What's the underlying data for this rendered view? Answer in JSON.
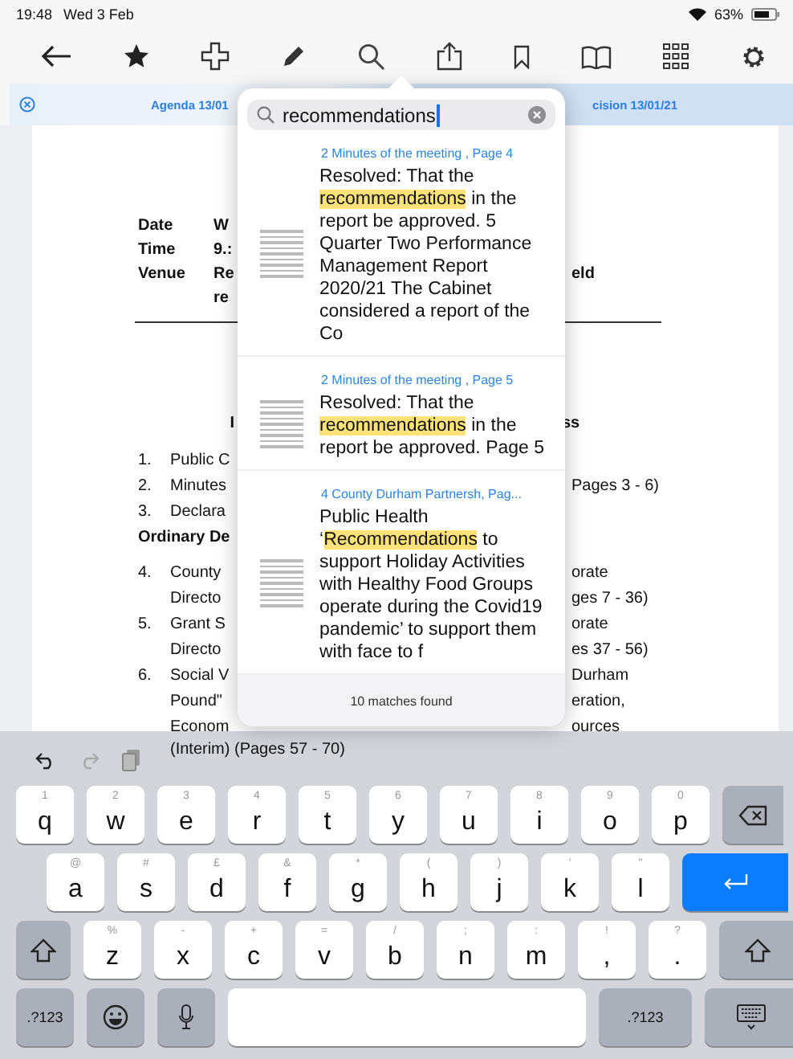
{
  "status_bar": {
    "time": "19:48",
    "date": "Wed 3 Feb",
    "battery": "63%"
  },
  "tabs": [
    {
      "label": "Agenda 13/01",
      "selected": false
    },
    {
      "label": "cision 13/01/21",
      "selected": true
    }
  ],
  "document": {
    "header": [
      {
        "label": "Date",
        "value": "W"
      },
      {
        "label": "Time",
        "value": "9.:"
      },
      {
        "label": "Venue",
        "value": "Re",
        "right": "eld"
      },
      {
        "value": "re"
      }
    ],
    "heading": {
      "left": "I",
      "right": "ss"
    },
    "items": [
      {
        "kind": "item",
        "num": "1.",
        "left": "Public C"
      },
      {
        "kind": "item",
        "num": "2.",
        "left": "Minutes",
        "right": "Pages 3 - 6)"
      },
      {
        "kind": "item",
        "num": "3.",
        "left": "Declara"
      },
      {
        "kind": "section",
        "left": "Ordinary De"
      },
      {
        "kind": "item",
        "num": "4.",
        "left": "County",
        "right": "orate"
      },
      {
        "kind": "item",
        "left": "Directo",
        "right": "ges 7 - 36)"
      },
      {
        "kind": "item",
        "num": "5.",
        "left": "Grant S",
        "right": "orate"
      },
      {
        "kind": "item",
        "left": "Directo",
        "right": "es 37 - 56)"
      },
      {
        "kind": "item",
        "num": "6.",
        "left": "Social V",
        "right": "Durham"
      },
      {
        "kind": "item",
        "left": "Pound\"",
        "right": "eration,"
      },
      {
        "kind": "item",
        "left": "Econom",
        "right": "ources"
      }
    ],
    "footer_line": "(Interim)  (Pages 57 - 70)"
  },
  "search": {
    "value": "recommendations",
    "results": [
      {
        "source": "2 Minutes of the meeting , Page 4",
        "before": "Resolved: That the ",
        "match": "recommendations",
        "after": " in the report be approved. 5 Quarter Two Performance Management Report 2020/21 The Cabinet considered a report of the Co"
      },
      {
        "source": "2 Minutes of the meeting , Page 5",
        "before": "Resolved: That the ",
        "match": "recommendations",
        "after": " in the report be approved. Page 5"
      },
      {
        "source": "4 County Durham Partnersh, Pag...",
        "before": "Public Health ‘",
        "match": "Recommendations",
        "after": " to support Holiday Activities with Healthy Food Groups operate during the Covid19 pandemic’ to support them with face to f"
      }
    ],
    "count": "10 matches found"
  },
  "keyboard": {
    "rows": [
      [
        {
          "kind": "char",
          "label": "q",
          "hint": "1"
        },
        {
          "kind": "char",
          "label": "w",
          "hint": "2"
        },
        {
          "kind": "char",
          "label": "e",
          "hint": "3"
        },
        {
          "kind": "char",
          "label": "r",
          "hint": "4"
        },
        {
          "kind": "char",
          "label": "t",
          "hint": "5"
        },
        {
          "kind": "char",
          "label": "y",
          "hint": "6"
        },
        {
          "kind": "char",
          "label": "u",
          "hint": "7"
        },
        {
          "kind": "char",
          "label": "i",
          "hint": "8"
        },
        {
          "kind": "char",
          "label": "o",
          "hint": "9"
        },
        {
          "kind": "char",
          "label": "p",
          "hint": "0"
        },
        {
          "kind": "backspace"
        }
      ],
      [
        {
          "kind": "char",
          "label": "a",
          "hint": "@"
        },
        {
          "kind": "char",
          "label": "s",
          "hint": "#"
        },
        {
          "kind": "char",
          "label": "d",
          "hint": "£"
        },
        {
          "kind": "char",
          "label": "f",
          "hint": "&"
        },
        {
          "kind": "char",
          "label": "g",
          "hint": "*"
        },
        {
          "kind": "char",
          "label": "h",
          "hint": "("
        },
        {
          "kind": "char",
          "label": "j",
          "hint": ")"
        },
        {
          "kind": "char",
          "label": "k",
          "hint": "'"
        },
        {
          "kind": "char",
          "label": "l",
          "hint": "\""
        },
        {
          "kind": "return"
        }
      ],
      [
        {
          "kind": "shift"
        },
        {
          "kind": "char",
          "label": "z",
          "hint": "%"
        },
        {
          "kind": "char",
          "label": "x",
          "hint": "-"
        },
        {
          "kind": "char",
          "label": "c",
          "hint": "+"
        },
        {
          "kind": "char",
          "label": "v",
          "hint": "="
        },
        {
          "kind": "char",
          "label": "b",
          "hint": "/"
        },
        {
          "kind": "char",
          "label": "n",
          "hint": ";"
        },
        {
          "kind": "char",
          "label": "m",
          "hint": ":"
        },
        {
          "kind": "punct",
          "label": ",",
          "hint": "!"
        },
        {
          "kind": "punct",
          "label": ".",
          "hint": "?"
        },
        {
          "kind": "shift"
        }
      ],
      [
        {
          "kind": "mode",
          "label": ".?123"
        },
        {
          "kind": "emoji"
        },
        {
          "kind": "mic"
        },
        {
          "kind": "space"
        },
        {
          "kind": "mode-wide",
          "label": ".?123"
        },
        {
          "kind": "hide"
        }
      ]
    ]
  }
}
